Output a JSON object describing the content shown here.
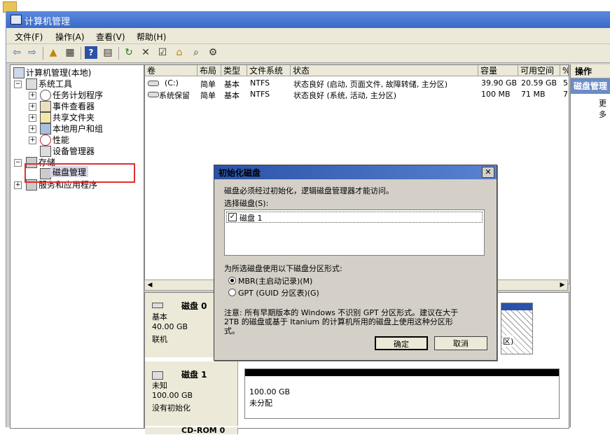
{
  "window": {
    "title": "计算机管理"
  },
  "menu": [
    "文件(F)",
    "操作(A)",
    "查看(V)",
    "帮助(H)"
  ],
  "tree": {
    "root": "计算机管理(本地)",
    "system_tools": "系统工具",
    "task_scheduler": "任务计划程序",
    "event_viewer": "事件查看器",
    "shared_folders": "共享文件夹",
    "local_users": "本地用户和组",
    "performance": "性能",
    "device_manager": "设备管理器",
    "storage": "存储",
    "disk_management": "磁盘管理",
    "services_apps": "服务和应用程序"
  },
  "volumes": {
    "headers": [
      "卷",
      "布局",
      "类型",
      "文件系统",
      "状态",
      "容量",
      "可用空间",
      "%"
    ],
    "rows": [
      [
        "(C:)",
        "简单",
        "基本",
        "NTFS",
        "状态良好 (启动, 页面文件, 故障转储, 主分区)",
        "39.90 GB",
        "20.59 GB",
        "5"
      ],
      [
        "系统保留",
        "简单",
        "基本",
        "NTFS",
        "状态良好 (系统, 活动, 主分区)",
        "100 MB",
        "71 MB",
        "7"
      ]
    ]
  },
  "disks": {
    "disk0": {
      "name": "磁盘 0",
      "type": "基本",
      "size": "40.00 GB",
      "status": "联机",
      "vol_frag": "区)"
    },
    "disk1": {
      "name": "磁盘 1",
      "type": "未知",
      "size": "100.00 GB",
      "status": "没有初始化",
      "unalloc_size": "100.00 GB",
      "unalloc_label": "未分配"
    },
    "cdrom": {
      "name": "CD-ROM 0"
    }
  },
  "actions": {
    "header": "操作",
    "item": "磁盘管理",
    "more": "更多"
  },
  "dialog": {
    "title": "初始化磁盘",
    "intro": "磁盘必须经过初始化，逻辑磁盘管理器才能访问。",
    "select_label": "选择磁盘(S):",
    "disk_item": "磁盘 1",
    "partition_label": "为所选磁盘使用以下磁盘分区形式:",
    "mbr": "MBR(主启动记录)(M)",
    "gpt": "GPT (GUID 分区表)(G)",
    "note_line1": "注意: 所有早期版本的 Windows 不识别 GPT 分区形式。建议在大于",
    "note_line2": "2TB 的磁盘或基于 Itanium 的计算机所用的磁盘上使用这种分区形",
    "note_line3": "式。",
    "ok": "确定",
    "cancel": "取消"
  }
}
